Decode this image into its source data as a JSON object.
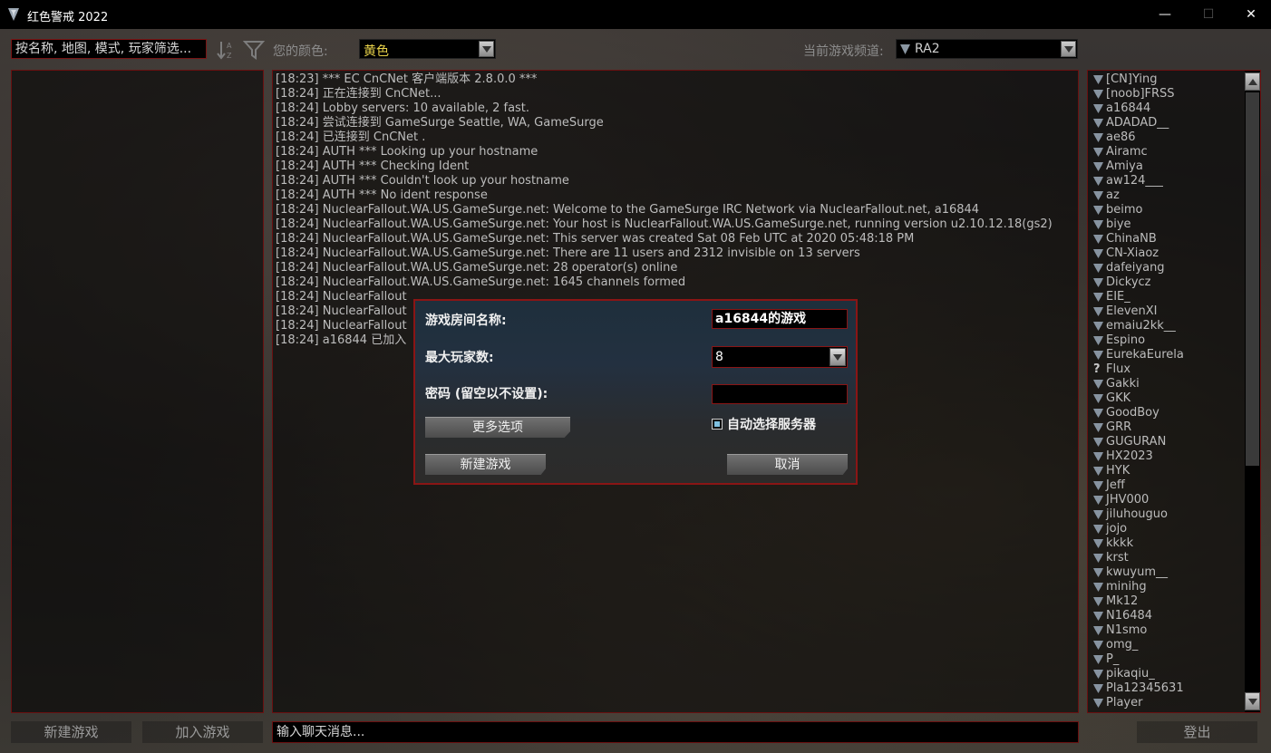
{
  "window": {
    "title": "红色警戒 2022",
    "minimize": "—",
    "maximize": "☐",
    "close": "✕"
  },
  "toolbar": {
    "filter_placeholder": "按名称, 地图, 模式, 玩家筛选...",
    "color_label": "您的颜色:",
    "color_value": "黄色",
    "color_value_color": "#e8d24a",
    "channel_label": "当前游戏频道:",
    "channel_value": "RA2"
  },
  "chat": {
    "lines": [
      "[18:23] *** EC CnCNet 客户端版本 2.8.0.0 ***",
      "[18:24] 正在连接到 CnCNet...",
      "[18:24] Lobby servers: 10 available, 2 fast.",
      "[18:24] 尝试连接到 GameSurge Seattle, WA, GameSurge",
      "[18:24] 已连接到 CnCNet .",
      "[18:24] AUTH *** Looking up your hostname",
      "[18:24] AUTH *** Checking Ident",
      "[18:24] AUTH *** Couldn't look up your hostname",
      "[18:24] AUTH *** No ident response",
      "[18:24] NuclearFallout.WA.US.GameSurge.net: Welcome to the GameSurge IRC Network via NuclearFallout.net, a16844",
      "[18:24] NuclearFallout.WA.US.GameSurge.net: Your host is NuclearFallout.WA.US.GameSurge.net, running version u2.10.12.18(gs2)",
      "[18:24] NuclearFallout.WA.US.GameSurge.net: This server was created Sat 08 Feb UTC at 2020 05:48:18 PM",
      "[18:24] NuclearFallout.WA.US.GameSurge.net: There are 11 users and 2312 invisible on 13 servers",
      "[18:24] NuclearFallout.WA.US.GameSurge.net: 28 operator(s) online",
      "[18:24] NuclearFallout.WA.US.GameSurge.net: 1645 channels formed",
      "[18:24] NuclearFallout",
      "[18:24] NuclearFallout",
      "[18:24] NuclearFallout",
      "[18:24] a16844 已加入"
    ],
    "input_placeholder": "输入聊天消息..."
  },
  "players": [
    {
      "name": "[CN]Ying",
      "icon": "ra2-icon"
    },
    {
      "name": "[noob]FRSS",
      "icon": "ra2-icon"
    },
    {
      "name": "a16844",
      "icon": "ra2-icon"
    },
    {
      "name": "ADADAD__",
      "icon": "ra2-icon"
    },
    {
      "name": "ae86",
      "icon": "ra2-icon"
    },
    {
      "name": "Airamc",
      "icon": "ra2-icon"
    },
    {
      "name": "Amiya",
      "icon": "ra2-icon"
    },
    {
      "name": "aw124___",
      "icon": "ra2-icon"
    },
    {
      "name": "az",
      "icon": "ra2-icon"
    },
    {
      "name": "beimo",
      "icon": "ra2-icon"
    },
    {
      "name": "biye",
      "icon": "ra2-icon"
    },
    {
      "name": "ChinaNB",
      "icon": "ra2-icon"
    },
    {
      "name": "CN-Xiaoz",
      "icon": "ra2-icon"
    },
    {
      "name": "dafeiyang",
      "icon": "ra2-icon"
    },
    {
      "name": "Dickycz",
      "icon": "ra2-icon"
    },
    {
      "name": "EIE_",
      "icon": "ra2-icon"
    },
    {
      "name": "ElevenXI",
      "icon": "ra2-icon"
    },
    {
      "name": "emaiu2kk__",
      "icon": "ra2-icon"
    },
    {
      "name": "Espino",
      "icon": "ra2-icon"
    },
    {
      "name": "EurekaEurela",
      "icon": "ra2-icon"
    },
    {
      "name": "Flux",
      "icon": "unknown-icon",
      "glyph": "?"
    },
    {
      "name": "Gakki",
      "icon": "ra2-icon"
    },
    {
      "name": "GKK",
      "icon": "ra2-icon"
    },
    {
      "name": "GoodBoy",
      "icon": "ra2-icon"
    },
    {
      "name": "GRR",
      "icon": "ra2-icon"
    },
    {
      "name": "GUGURAN",
      "icon": "ra2-icon"
    },
    {
      "name": "HX2023",
      "icon": "ra2-icon"
    },
    {
      "name": "HYK",
      "icon": "ra2-icon"
    },
    {
      "name": "Jeff",
      "icon": "ra2-icon"
    },
    {
      "name": "JHV000",
      "icon": "ra2-icon"
    },
    {
      "name": "jiluhouguo",
      "icon": "ra2-icon"
    },
    {
      "name": "jojo",
      "icon": "ra2-icon"
    },
    {
      "name": "kkkk",
      "icon": "ra2-icon"
    },
    {
      "name": "krst",
      "icon": "ra2-icon"
    },
    {
      "name": "kwuyum__",
      "icon": "ra2-icon"
    },
    {
      "name": "minihg",
      "icon": "ra2-icon"
    },
    {
      "name": "Mk12",
      "icon": "ra2-icon"
    },
    {
      "name": "N16484",
      "icon": "ra2-icon"
    },
    {
      "name": "N1smo",
      "icon": "ra2-icon"
    },
    {
      "name": "omg_",
      "icon": "ra2-icon"
    },
    {
      "name": "P_",
      "icon": "ra2-icon"
    },
    {
      "name": "pikaqiu_",
      "icon": "ra2-icon"
    },
    {
      "name": "Pla12345631",
      "icon": "ra2-icon"
    },
    {
      "name": "Player",
      "icon": "ra2-icon"
    }
  ],
  "bottom": {
    "new_game": "新建游戏",
    "join_game": "加入游戏",
    "logout": "登出"
  },
  "dialog": {
    "room_name_label": "游戏房间名称:",
    "room_name_value": "a16844的游戏",
    "max_players_label": "最大玩家数:",
    "max_players_value": "8",
    "password_label": "密码 (留空以不设置):",
    "password_value": "",
    "more_options": "更多选项",
    "auto_server_label": "自动选择服务器",
    "auto_server_checked": true,
    "create": "新建游戏",
    "cancel": "取消"
  }
}
